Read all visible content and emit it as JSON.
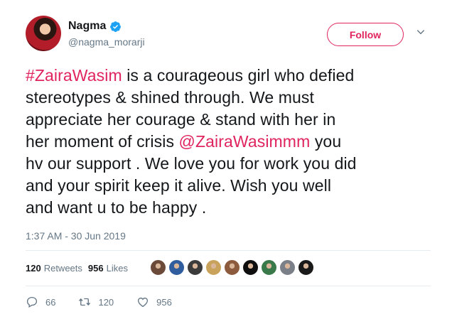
{
  "user": {
    "display_name": "Nagma",
    "handle": "@nagma_morarji",
    "verified": true,
    "follow_label": "Follow"
  },
  "tweet": {
    "lines": [
      [
        {
          "text": "#ZairaWasim",
          "tag": true
        },
        {
          "text": " is a courageous girl who defied",
          "tag": false
        }
      ],
      [
        {
          "text": "stereotypes & shined through. We must",
          "tag": false
        }
      ],
      [
        {
          "text": "appreciate her courage & stand with her in",
          "tag": false
        }
      ],
      [
        {
          "text": "her moment of crisis  ",
          "tag": false
        },
        {
          "text": "@ZairaWasimmm",
          "tag": true
        },
        {
          "text": " you",
          "tag": false
        }
      ],
      [
        {
          "text": "hv our support . We love you for work you did",
          "tag": false
        }
      ],
      [
        {
          "text": "and your spirit keep it alive. Wish you well",
          "tag": false
        }
      ],
      [
        {
          "text": "and want u to be happy .",
          "tag": false
        }
      ]
    ],
    "timestamp": "1:37 AM - 30 Jun 2019"
  },
  "stats": {
    "retweets_count": "120",
    "retweets_label": "Retweets",
    "likes_count": "956",
    "likes_label": "Likes",
    "liker_avatars": [
      "#6b4a3a",
      "#2f5d9e",
      "#3b3b3b",
      "#c9a35b",
      "#8c5a3c",
      "#0f0f0f",
      "#3a7a4a",
      "#7a7f88",
      "#1a1a1a"
    ]
  },
  "actions": {
    "replies": "66",
    "retweets": "120",
    "likes": "956"
  },
  "colors": {
    "accent": "#e0245e",
    "verified": "#1da1f2",
    "muted": "#657786"
  }
}
